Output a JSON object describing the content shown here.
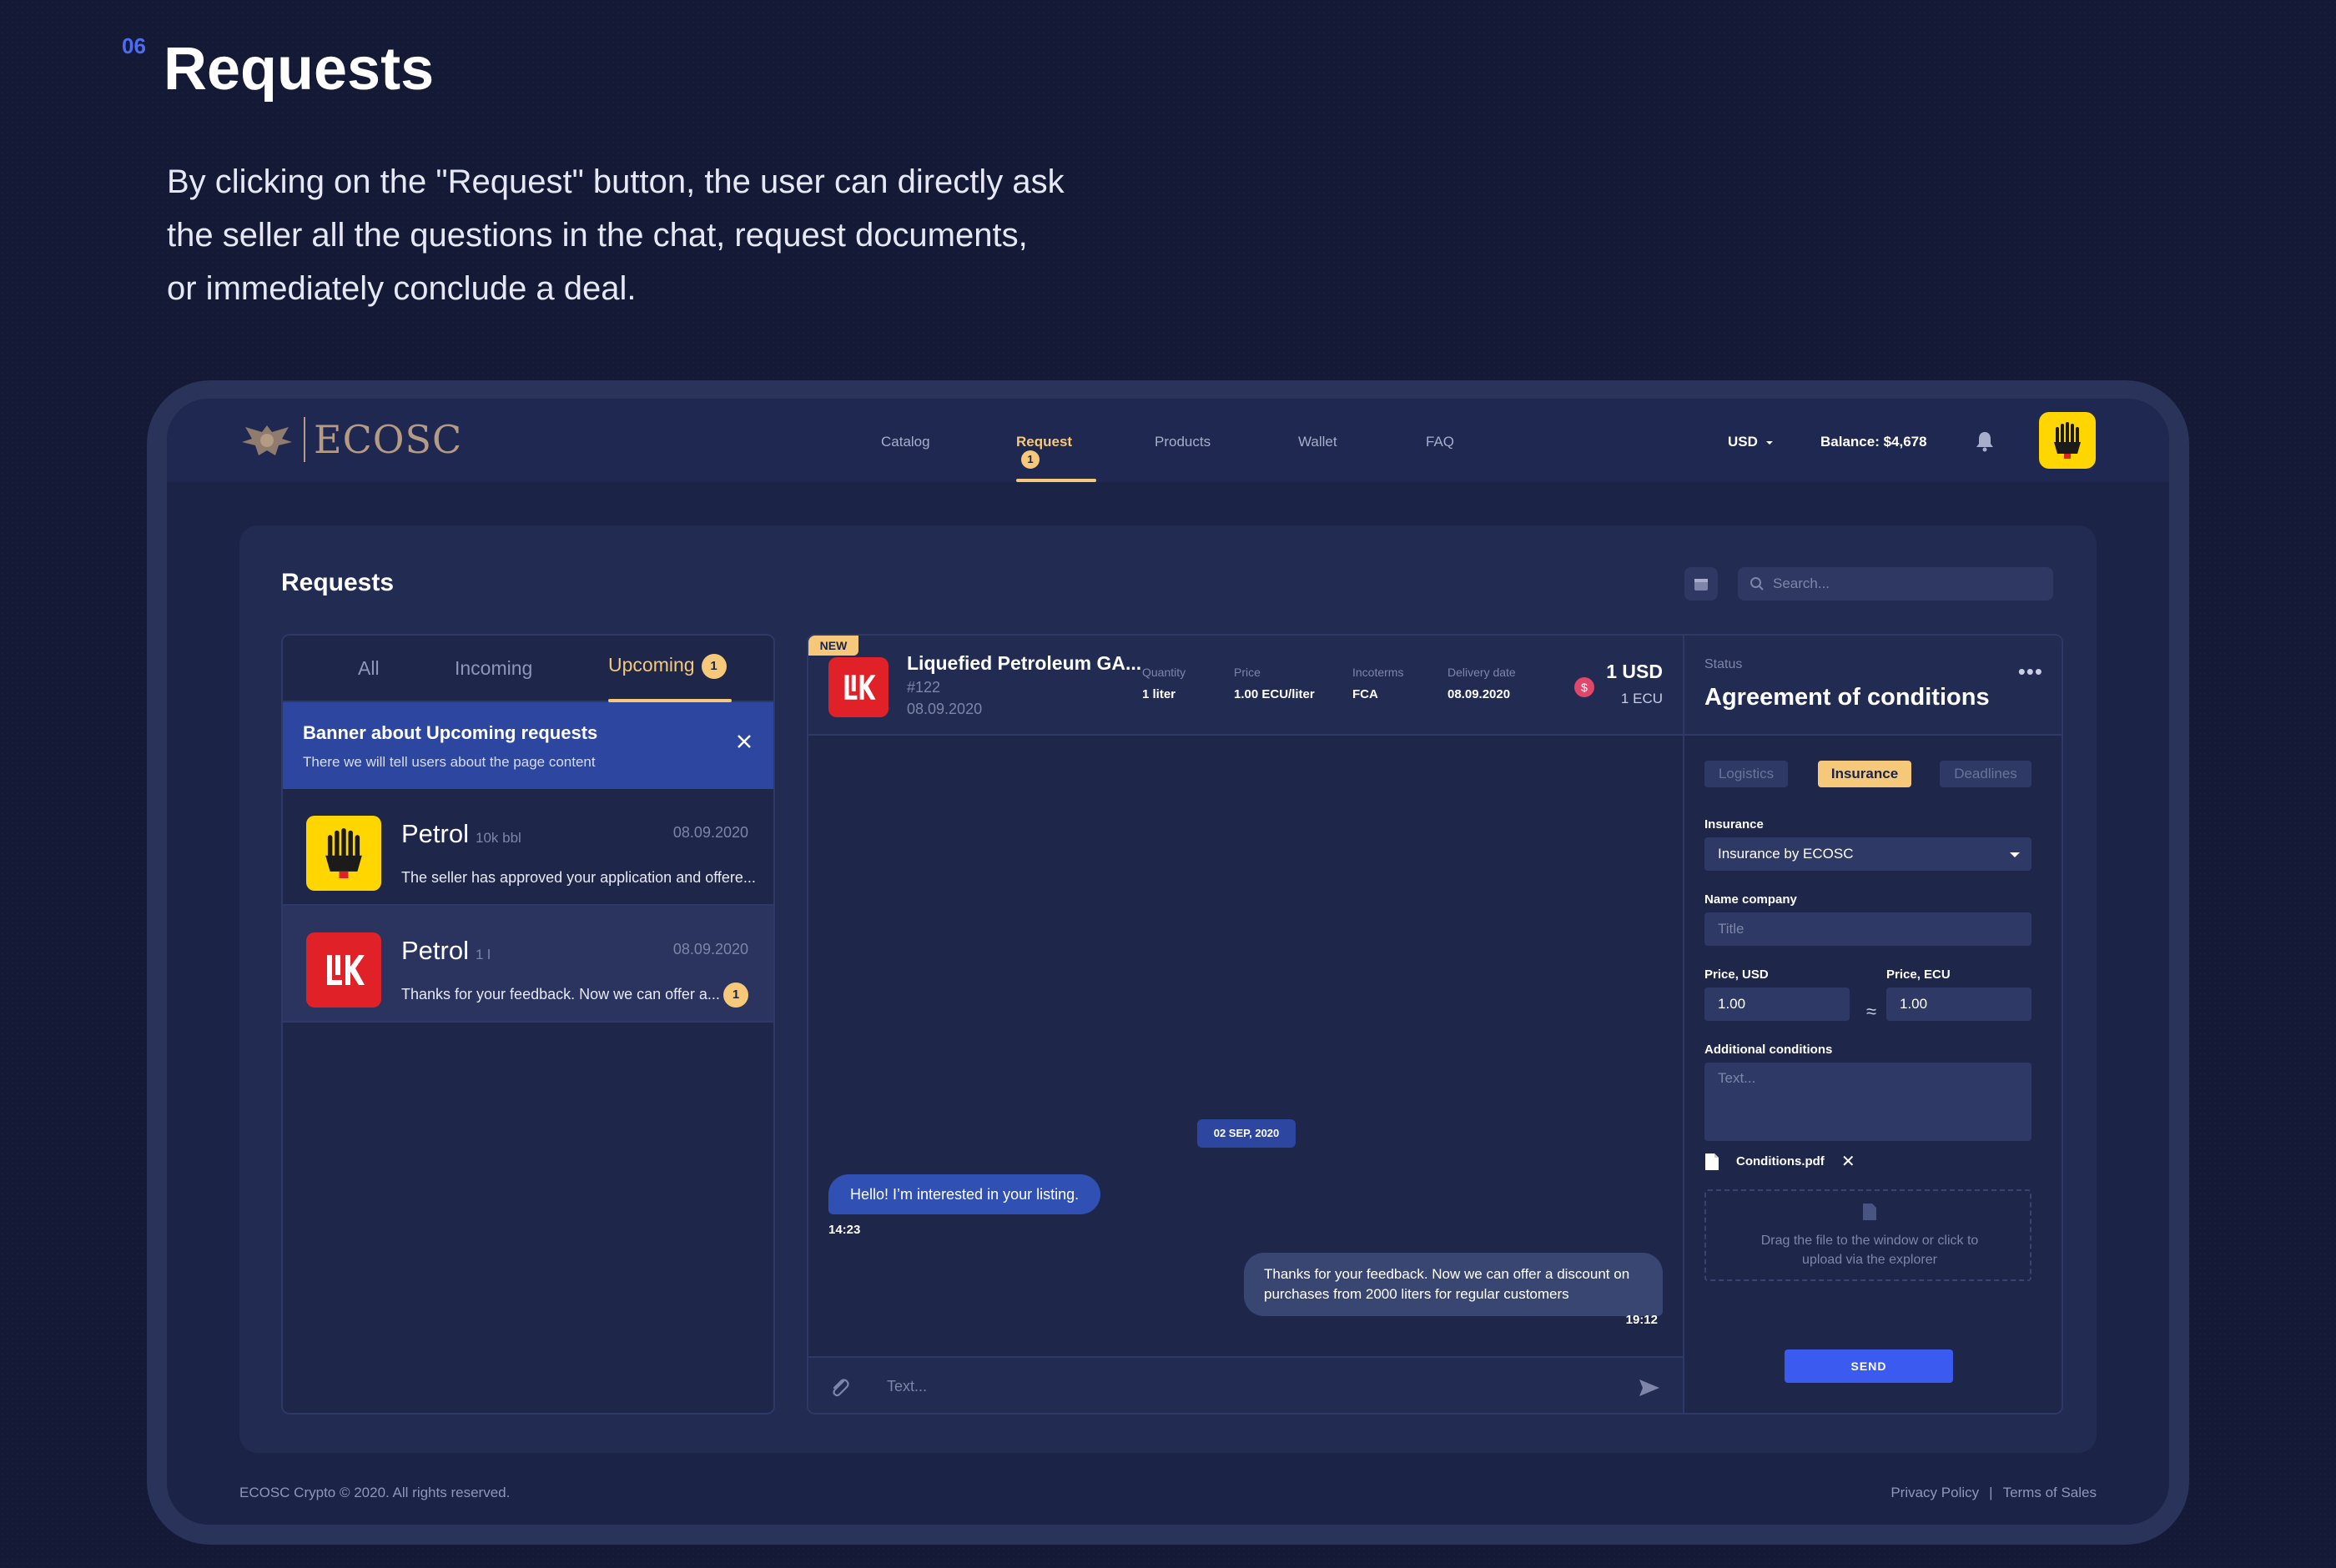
{
  "section": {
    "number": "06",
    "title": "Requests",
    "description": "By clicking on the \"Request\" button, the user can directly ask\nthe seller all the questions in the chat, request documents,\nor immediately conclude a deal."
  },
  "header": {
    "logo_text": "ECOSC",
    "nav": [
      {
        "label": "Catalog"
      },
      {
        "label": "Request",
        "badge": "1"
      },
      {
        "label": "Products"
      },
      {
        "label": "Wallet"
      },
      {
        "label": "FAQ"
      }
    ],
    "currency": "USD",
    "balance": "Balance: $4,678"
  },
  "panel": {
    "title": "Requests",
    "search_placeholder": "Search..."
  },
  "list": {
    "tabs": [
      {
        "label": "All"
      },
      {
        "label": "Incoming"
      },
      {
        "label": "Upcoming",
        "badge": "1"
      }
    ],
    "banner": {
      "title": "Banner about Upcoming requests",
      "subtitle": "There we will tell users about the page content"
    },
    "items": [
      {
        "name": "Petrol",
        "qty": "10k bbl",
        "date": "08.09.2020",
        "message": "The seller has approved your application and offere...",
        "brand": "shell-yellow"
      },
      {
        "name": "Petrol",
        "qty": "1 l",
        "date": "08.09.2020",
        "message": "Thanks for your feedback. Now we can offer a...",
        "badge": "1",
        "brand": "lukoil-red"
      }
    ]
  },
  "chat": {
    "new_tag": "NEW",
    "product": {
      "name": "Liquefied Petroleum GA...",
      "id": "#122",
      "date": "08.09.2020"
    },
    "meta": [
      {
        "label": "Quantity",
        "value": "1 liter"
      },
      {
        "label": "Price",
        "value": "1.00 ECU/liter"
      },
      {
        "label": "Incoterms",
        "value": "FCA"
      },
      {
        "label": "Delivery date",
        "value": "08.09.2020"
      }
    ],
    "currency_icon": "$",
    "amount_primary": "1 USD",
    "amount_secondary": "1 ECU",
    "date_chip": "02 SEP, 2020",
    "messages": [
      {
        "text": "Hello! I’m interested in your listing.",
        "time": "14:23"
      },
      {
        "text": "Thanks for your feedback. Now we can offer a discount on purchases from 2000 liters for regular customers",
        "time": "19:12"
      }
    ],
    "input_placeholder": "Text..."
  },
  "side": {
    "status_label": "Status",
    "status_value": "Agreement of conditions",
    "more": "•••",
    "tabs": [
      {
        "label": "Logistics"
      },
      {
        "label": "Insurance"
      },
      {
        "label": "Deadlines"
      }
    ],
    "insurance_label": "Insurance",
    "insurance_value": "Insurance by ECOSC",
    "name_company_label": "Name company",
    "name_company_placeholder": "Title",
    "price_usd_label": "Price, USD",
    "price_usd_value": "1.00",
    "approx": "≈",
    "price_ecu_label": "Price, ECU",
    "price_ecu_value": "1.00",
    "additional_label": "Additional conditions",
    "additional_placeholder": "Text...",
    "file_name": "Conditions.pdf",
    "file_remove": "✕",
    "drop_text": "Drag the file to the window or click to\nupload via the explorer",
    "send_label": "SEND"
  },
  "footer": {
    "copyright": "ECOSC Crypto © 2020. All rights reserved.",
    "privacy": "Privacy Policy",
    "separator": "|",
    "terms": "Terms of Sales"
  },
  "colors": {
    "background": "#141a36",
    "accent": "#f6c97a",
    "primary_button": "#3b5bf0",
    "banner": "#2d46a0",
    "shell_yellow": "#ffd600",
    "lukoil_red": "#e02128"
  }
}
